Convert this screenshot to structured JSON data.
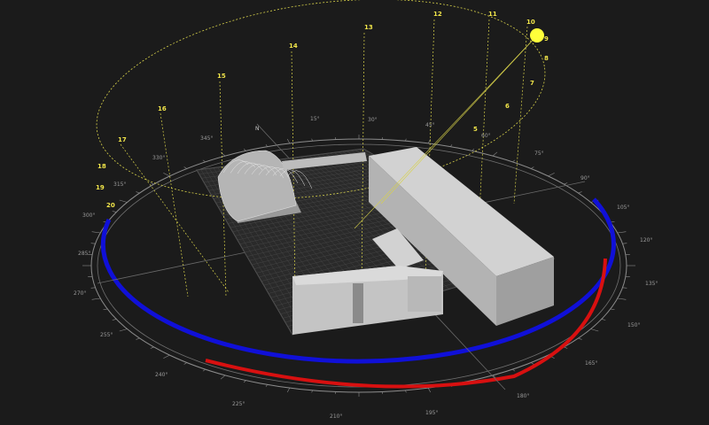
{
  "colors": {
    "background": "#1b1b1b",
    "sun": "#ffff3a",
    "sun_path": "#d8d24a",
    "summer_arc": "#1010d8",
    "winter_arc": "#d81010",
    "building_top": "#c8c8c8",
    "building_side": "#a8a8a8",
    "compass": "#8c8c8c"
  },
  "hour_labels": [
    "17",
    "16",
    "15",
    "14",
    "13",
    "12",
    "11",
    "10"
  ],
  "hour_labels_small_left": [
    "18",
    "19",
    "20"
  ],
  "hour_labels_small_right": [
    "9",
    "8",
    "7",
    "6",
    "5"
  ],
  "north_label": "N",
  "degree_labels": [
    "15°",
    "30°",
    "45°",
    "60°",
    "75°",
    "90°",
    "105°",
    "120°",
    "135°",
    "150°",
    "165°",
    "180°",
    "195°",
    "210°",
    "225°",
    "240°",
    "255°",
    "270°",
    "285°",
    "300°",
    "315°",
    "330°",
    "345°"
  ]
}
